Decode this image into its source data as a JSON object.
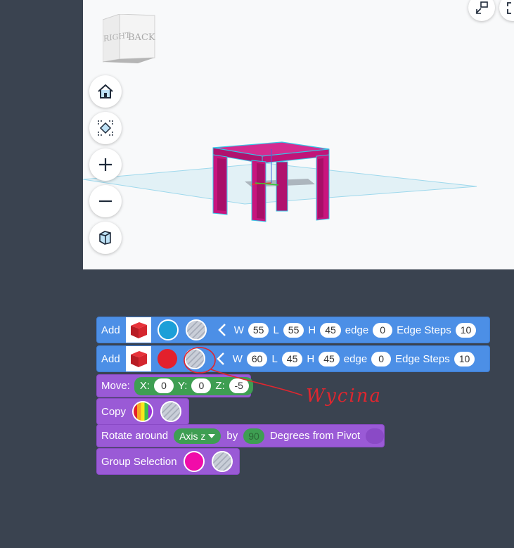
{
  "viewcube": {
    "left_face": "RIGHT",
    "front_face": "BACK"
  },
  "nav": [
    {
      "name": "home-icon"
    },
    {
      "name": "fit-view-icon"
    },
    {
      "name": "zoom-in-icon"
    },
    {
      "name": "zoom-out-icon"
    },
    {
      "name": "perspective-icon"
    }
  ],
  "top_right": [
    {
      "name": "collapse-icon"
    },
    {
      "name": "fullscreen-icon"
    }
  ],
  "blocks": {
    "add1": {
      "label": "Add",
      "w_label": "W",
      "w": "55",
      "l_label": "L",
      "l": "55",
      "h_label": "H",
      "h": "45",
      "edge_label": "edge",
      "edge": "0",
      "steps_label": "Edge Steps",
      "steps": "10",
      "color": "#1c9fd8"
    },
    "add2": {
      "label": "Add",
      "w_label": "W",
      "w": "60",
      "l_label": "L",
      "l": "45",
      "h_label": "H",
      "h": "45",
      "edge_label": "edge",
      "edge": "0",
      "steps_label": "Edge Steps",
      "steps": "10",
      "color": "#e3202c"
    },
    "move": {
      "label": "Move:",
      "x_label": "X:",
      "x": "0",
      "y_label": "Y:",
      "y": "0",
      "z_label": "Z:",
      "z": "-5"
    },
    "copy": {
      "label": "Copy"
    },
    "rotate": {
      "label": "Rotate around",
      "axis": "Axis z",
      "by": "by",
      "degrees": "90",
      "suffix": "Degrees from Pivot"
    },
    "group": {
      "label": "Group Selection",
      "color": "#f10ca9"
    }
  },
  "annotation": {
    "text": "Wycina"
  },
  "colors": {
    "accent_blue": "#4c8fe6",
    "accent_purple": "#9a5ad6",
    "table": "#c8157e"
  }
}
